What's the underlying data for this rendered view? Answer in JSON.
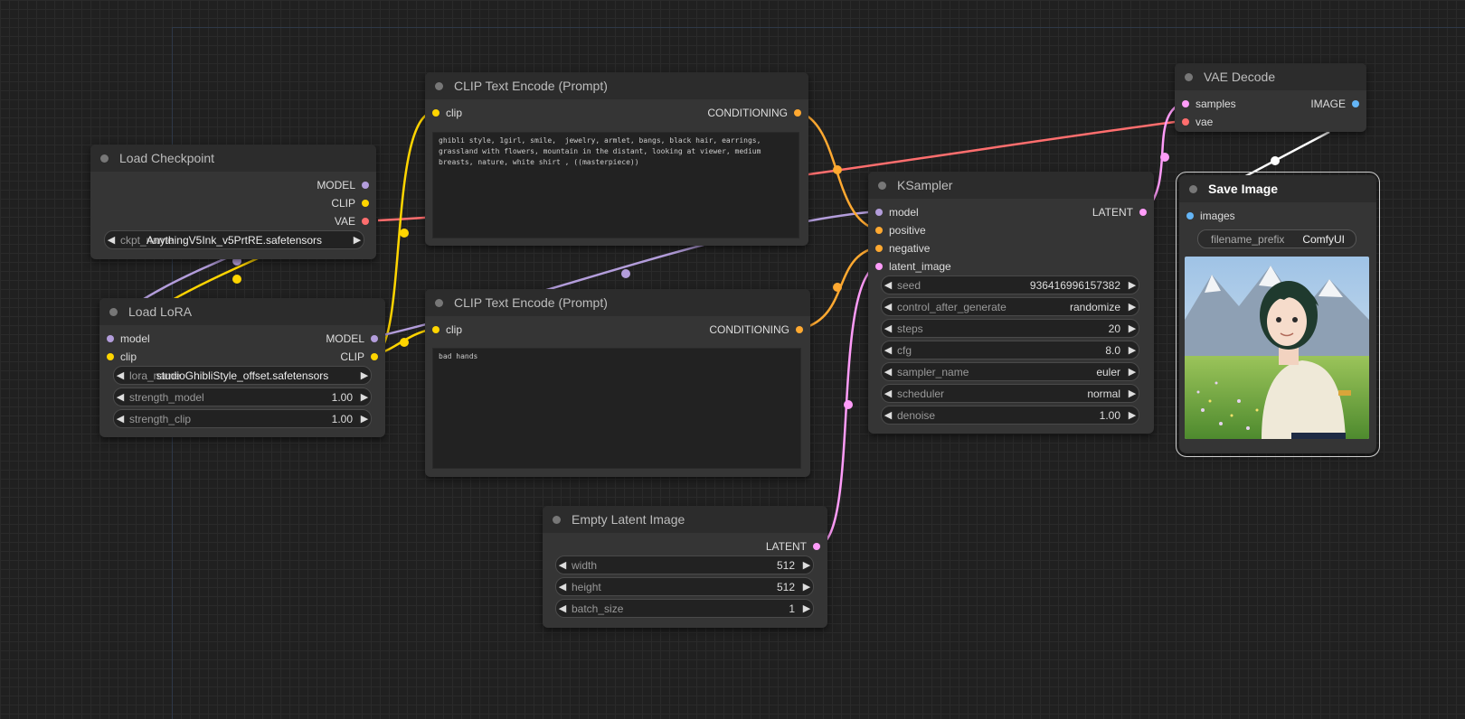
{
  "nodes": {
    "load_checkpoint": {
      "title": "Load Checkpoint",
      "outputs": [
        "MODEL",
        "CLIP",
        "VAE"
      ],
      "ckpt_label": "ckpt_name",
      "ckpt_value": "AnythingV5Ink_v5PrtRE.safetensors"
    },
    "load_lora": {
      "title": "Load LoRA",
      "inputs": [
        "model",
        "clip"
      ],
      "outputs": [
        "MODEL",
        "CLIP"
      ],
      "widgets": [
        {
          "label": "lora_name",
          "value": "studioGhibliStyle_offset.safetensors"
        },
        {
          "label": "strength_model",
          "value": "1.00"
        },
        {
          "label": "strength_clip",
          "value": "1.00"
        }
      ]
    },
    "clip_pos": {
      "title": "CLIP Text Encode (Prompt)",
      "input": "clip",
      "output": "CONDITIONING",
      "text": "ghibli style, 1girl, smile,  jewelry, armlet, bangs, black hair, earrings, grassland with flowers, mountain in the distant, looking at viewer, medium breasts, nature, white shirt , ((masterpiece))"
    },
    "clip_neg": {
      "title": "CLIP Text Encode (Prompt)",
      "input": "clip",
      "output": "CONDITIONING",
      "text": "bad hands"
    },
    "empty_latent": {
      "title": "Empty Latent Image",
      "output": "LATENT",
      "widgets": [
        {
          "label": "width",
          "value": "512"
        },
        {
          "label": "height",
          "value": "512"
        },
        {
          "label": "batch_size",
          "value": "1"
        }
      ]
    },
    "ksampler": {
      "title": "KSampler",
      "inputs": [
        "model",
        "positive",
        "negative",
        "latent_image"
      ],
      "output": "LATENT",
      "widgets": [
        {
          "label": "seed",
          "value": "936416996157382"
        },
        {
          "label": "control_after_generate",
          "value": "randomize"
        },
        {
          "label": "steps",
          "value": "20"
        },
        {
          "label": "cfg",
          "value": "8.0"
        },
        {
          "label": "sampler_name",
          "value": "euler"
        },
        {
          "label": "scheduler",
          "value": "normal"
        },
        {
          "label": "denoise",
          "value": "1.00"
        }
      ]
    },
    "vae_decode": {
      "title": "VAE Decode",
      "inputs": [
        "samples",
        "vae"
      ],
      "output": "IMAGE"
    },
    "save_image": {
      "title": "Save Image",
      "input": "images",
      "prefix_label": "filename_prefix",
      "prefix_value": "ComfyUI"
    }
  },
  "colors": {
    "model": "#b39ddb",
    "clip": "#ffd500",
    "vae": "#ff6e6e",
    "conditioning": "#ffa931",
    "latent": "#ff9cf9",
    "image": "#64b5f6",
    "canvas": "#202020",
    "node": "#353535"
  },
  "icons": {
    "widget_left": "triangle-left",
    "widget_right": "triangle-right"
  }
}
